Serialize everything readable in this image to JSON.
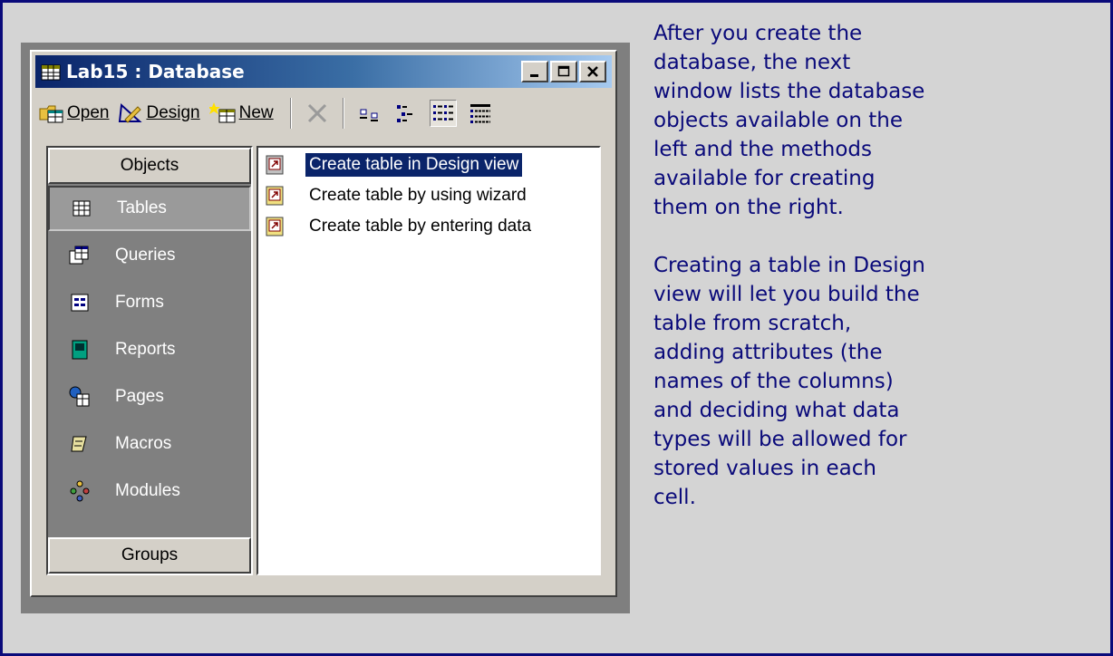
{
  "window": {
    "title": "Lab15 : Database",
    "caption_buttons": [
      "minimize",
      "maximize",
      "close"
    ]
  },
  "toolbar": {
    "open_label": "Open",
    "design_label": "Design",
    "new_label": "New",
    "icons": [
      "delete-icon",
      "large-icons-icon",
      "small-icons-icon",
      "list-view-icon",
      "details-view-icon"
    ],
    "selected_view": "list"
  },
  "objects_bar": {
    "header": "Objects",
    "items": [
      {
        "label": "Tables",
        "icon": "table-icon",
        "selected": true
      },
      {
        "label": "Queries",
        "icon": "query-icon"
      },
      {
        "label": "Forms",
        "icon": "form-icon"
      },
      {
        "label": "Reports",
        "icon": "report-icon"
      },
      {
        "label": "Pages",
        "icon": "page-icon"
      },
      {
        "label": "Macros",
        "icon": "macro-icon"
      },
      {
        "label": "Modules",
        "icon": "module-icon"
      }
    ],
    "groups_label": "Groups"
  },
  "list": {
    "items": [
      {
        "label": "Create table in Design view",
        "selected": true
      },
      {
        "label": "Create table by using wizard"
      },
      {
        "label": "Create table by entering data"
      }
    ]
  },
  "description": {
    "paragraphs": [
      "After you create the database, the next window lists the database objects available on the left and the methods available for creating them on the right.",
      "Creating a table in Design view will let you build the table from scratch, adding attributes (the names of the columns) and deciding what data types will be allowed for stored values in each cell."
    ]
  },
  "colors": {
    "frame_border": "#0a0a7a",
    "text": "#0a0a7a",
    "titlebar_start": "#0a246a",
    "titlebar_end": "#a6caf0",
    "selection": "#0a246a"
  }
}
